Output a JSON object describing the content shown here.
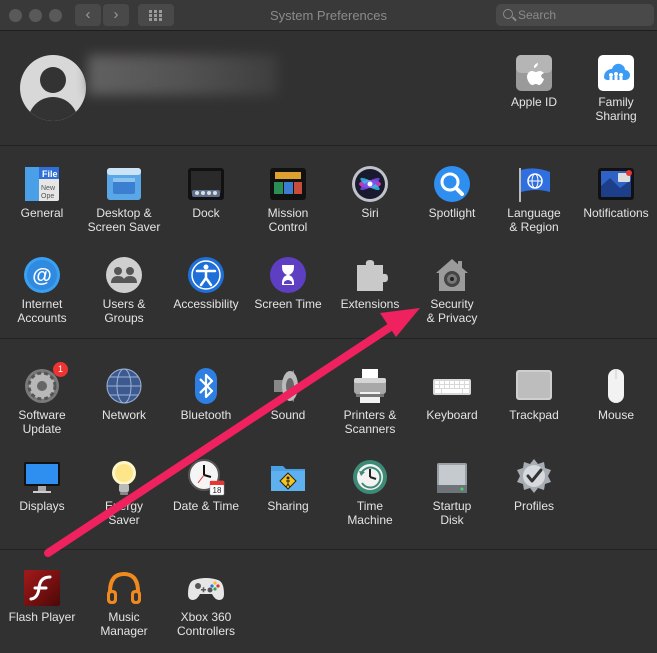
{
  "window": {
    "title": "System Preferences"
  },
  "search": {
    "placeholder": "Search"
  },
  "account": {
    "apple_id": "Apple ID",
    "family_sharing": "Family\nSharing"
  },
  "row1": [
    {
      "label": "General",
      "icon": "general-icon"
    },
    {
      "label": "Desktop &\nScreen Saver",
      "icon": "desktop-icon"
    },
    {
      "label": "Dock",
      "icon": "dock-icon"
    },
    {
      "label": "Mission\nControl",
      "icon": "mission-control-icon"
    },
    {
      "label": "Siri",
      "icon": "siri-icon"
    },
    {
      "label": "Spotlight",
      "icon": "spotlight-icon"
    },
    {
      "label": "Language\n& Region",
      "icon": "language-icon"
    },
    {
      "label": "Notifications",
      "icon": "notifications-icon"
    }
  ],
  "row2": [
    {
      "label": "Internet\nAccounts",
      "icon": "internet-accounts-icon"
    },
    {
      "label": "Users &\nGroups",
      "icon": "users-icon"
    },
    {
      "label": "Accessibility",
      "icon": "accessibility-icon"
    },
    {
      "label": "Screen Time",
      "icon": "screen-time-icon"
    },
    {
      "label": "Extensions",
      "icon": "extensions-icon"
    },
    {
      "label": "Security\n& Privacy",
      "icon": "security-icon"
    }
  ],
  "row3": [
    {
      "label": "Software\nUpdate",
      "icon": "software-update-icon",
      "badge": "1"
    },
    {
      "label": "Network",
      "icon": "network-icon"
    },
    {
      "label": "Bluetooth",
      "icon": "bluetooth-icon"
    },
    {
      "label": "Sound",
      "icon": "sound-icon"
    },
    {
      "label": "Printers &\nScanners",
      "icon": "printer-icon"
    },
    {
      "label": "Keyboard",
      "icon": "keyboard-icon"
    },
    {
      "label": "Trackpad",
      "icon": "trackpad-icon"
    },
    {
      "label": "Mouse",
      "icon": "mouse-icon"
    }
  ],
  "row4": [
    {
      "label": "Displays",
      "icon": "display-icon"
    },
    {
      "label": "Energy\nSaver",
      "icon": "energy-icon"
    },
    {
      "label": "Date & Time",
      "icon": "clock-icon",
      "calendar_day": "18"
    },
    {
      "label": "Sharing",
      "icon": "sharing-icon"
    },
    {
      "label": "Time\nMachine",
      "icon": "time-machine-icon"
    },
    {
      "label": "Startup\nDisk",
      "icon": "startup-disk-icon"
    },
    {
      "label": "Profiles",
      "icon": "profiles-icon"
    }
  ],
  "row5": [
    {
      "label": "Flash Player",
      "icon": "flash-icon"
    },
    {
      "label": "Music\nManager",
      "icon": "headphones-icon"
    },
    {
      "label": "Xbox 360\nControllers",
      "icon": "gamepad-icon"
    }
  ],
  "colors": {
    "arrow": "#f0215f",
    "background": "#323131"
  }
}
